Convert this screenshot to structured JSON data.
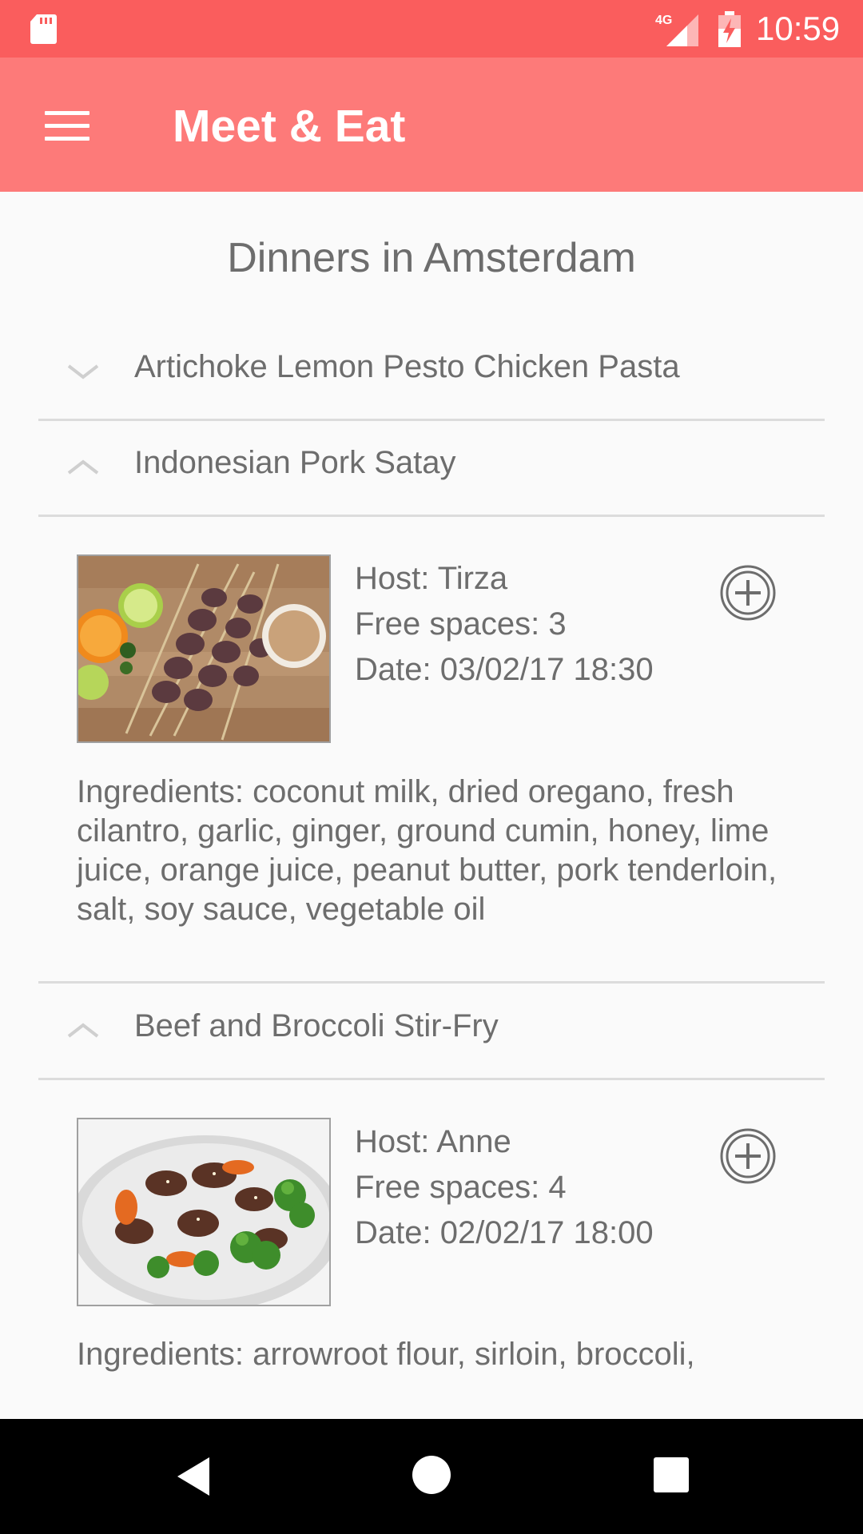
{
  "status_bar": {
    "network": "4G",
    "time": "10:59"
  },
  "app_bar": {
    "title": "Meet & Eat"
  },
  "page": {
    "title": "Dinners in Amsterdam"
  },
  "dinners": [
    {
      "name": "Artichoke Lemon Pesto Chicken Pasta",
      "expanded": false
    },
    {
      "name": "Indonesian Pork Satay",
      "expanded": true,
      "host": "Host: Tirza",
      "free_spaces": "Free spaces: 3",
      "date": "Date: 03/02/17 18:30",
      "ingredients": "Ingredients: coconut milk, dried oregano, fresh cilantro, garlic, ginger, ground cumin, honey, lime juice, orange juice, peanut butter, pork tenderloin, salt, soy sauce, vegetable oil"
    },
    {
      "name": "Beef and Broccoli Stir-Fry",
      "expanded": true,
      "host": "Host: Anne",
      "free_spaces": "Free spaces: 4",
      "date": "Date: 02/02/17 18:00",
      "ingredients": "Ingredients: arrowroot flour, sirloin, broccoli,"
    }
  ],
  "colors": {
    "status_bar": "#fa5d5d",
    "app_bar": "#fd7a79",
    "text": "#6d6d6d",
    "divider": "#dcdcdc"
  },
  "icons": {
    "menu": "hamburger-menu-icon",
    "expand": "chevron-down-icon",
    "collapse": "chevron-up-icon",
    "add": "plus-circle-icon"
  }
}
